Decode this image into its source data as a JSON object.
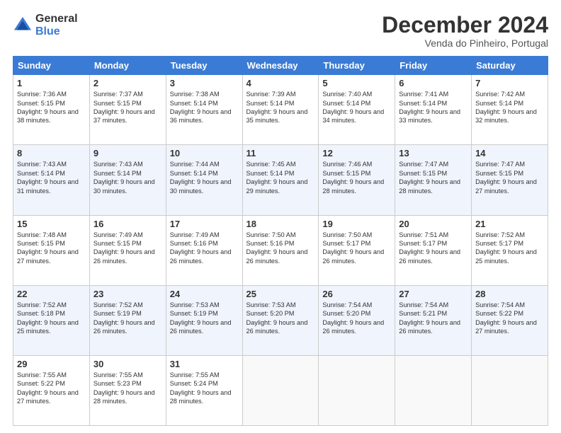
{
  "logo": {
    "general": "General",
    "blue": "Blue"
  },
  "title": "December 2024",
  "location": "Venda do Pinheiro, Portugal",
  "days_of_week": [
    "Sunday",
    "Monday",
    "Tuesday",
    "Wednesday",
    "Thursday",
    "Friday",
    "Saturday"
  ],
  "weeks": [
    [
      {
        "day": "1",
        "sunrise": "7:36 AM",
        "sunset": "5:15 PM",
        "daylight": "9 hours and 38 minutes."
      },
      {
        "day": "2",
        "sunrise": "7:37 AM",
        "sunset": "5:15 PM",
        "daylight": "9 hours and 37 minutes."
      },
      {
        "day": "3",
        "sunrise": "7:38 AM",
        "sunset": "5:14 PM",
        "daylight": "9 hours and 36 minutes."
      },
      {
        "day": "4",
        "sunrise": "7:39 AM",
        "sunset": "5:14 PM",
        "daylight": "9 hours and 35 minutes."
      },
      {
        "day": "5",
        "sunrise": "7:40 AM",
        "sunset": "5:14 PM",
        "daylight": "9 hours and 34 minutes."
      },
      {
        "day": "6",
        "sunrise": "7:41 AM",
        "sunset": "5:14 PM",
        "daylight": "9 hours and 33 minutes."
      },
      {
        "day": "7",
        "sunrise": "7:42 AM",
        "sunset": "5:14 PM",
        "daylight": "9 hours and 32 minutes."
      }
    ],
    [
      {
        "day": "8",
        "sunrise": "7:43 AM",
        "sunset": "5:14 PM",
        "daylight": "9 hours and 31 minutes."
      },
      {
        "day": "9",
        "sunrise": "7:43 AM",
        "sunset": "5:14 PM",
        "daylight": "9 hours and 30 minutes."
      },
      {
        "day": "10",
        "sunrise": "7:44 AM",
        "sunset": "5:14 PM",
        "daylight": "9 hours and 30 minutes."
      },
      {
        "day": "11",
        "sunrise": "7:45 AM",
        "sunset": "5:14 PM",
        "daylight": "9 hours and 29 minutes."
      },
      {
        "day": "12",
        "sunrise": "7:46 AM",
        "sunset": "5:15 PM",
        "daylight": "9 hours and 28 minutes."
      },
      {
        "day": "13",
        "sunrise": "7:47 AM",
        "sunset": "5:15 PM",
        "daylight": "9 hours and 28 minutes."
      },
      {
        "day": "14",
        "sunrise": "7:47 AM",
        "sunset": "5:15 PM",
        "daylight": "9 hours and 27 minutes."
      }
    ],
    [
      {
        "day": "15",
        "sunrise": "7:48 AM",
        "sunset": "5:15 PM",
        "daylight": "9 hours and 27 minutes."
      },
      {
        "day": "16",
        "sunrise": "7:49 AM",
        "sunset": "5:15 PM",
        "daylight": "9 hours and 26 minutes."
      },
      {
        "day": "17",
        "sunrise": "7:49 AM",
        "sunset": "5:16 PM",
        "daylight": "9 hours and 26 minutes."
      },
      {
        "day": "18",
        "sunrise": "7:50 AM",
        "sunset": "5:16 PM",
        "daylight": "9 hours and 26 minutes."
      },
      {
        "day": "19",
        "sunrise": "7:50 AM",
        "sunset": "5:17 PM",
        "daylight": "9 hours and 26 minutes."
      },
      {
        "day": "20",
        "sunrise": "7:51 AM",
        "sunset": "5:17 PM",
        "daylight": "9 hours and 26 minutes."
      },
      {
        "day": "21",
        "sunrise": "7:52 AM",
        "sunset": "5:17 PM",
        "daylight": "9 hours and 25 minutes."
      }
    ],
    [
      {
        "day": "22",
        "sunrise": "7:52 AM",
        "sunset": "5:18 PM",
        "daylight": "9 hours and 25 minutes."
      },
      {
        "day": "23",
        "sunrise": "7:52 AM",
        "sunset": "5:19 PM",
        "daylight": "9 hours and 26 minutes."
      },
      {
        "day": "24",
        "sunrise": "7:53 AM",
        "sunset": "5:19 PM",
        "daylight": "9 hours and 26 minutes."
      },
      {
        "day": "25",
        "sunrise": "7:53 AM",
        "sunset": "5:20 PM",
        "daylight": "9 hours and 26 minutes."
      },
      {
        "day": "26",
        "sunrise": "7:54 AM",
        "sunset": "5:20 PM",
        "daylight": "9 hours and 26 minutes."
      },
      {
        "day": "27",
        "sunrise": "7:54 AM",
        "sunset": "5:21 PM",
        "daylight": "9 hours and 26 minutes."
      },
      {
        "day": "28",
        "sunrise": "7:54 AM",
        "sunset": "5:22 PM",
        "daylight": "9 hours and 27 minutes."
      }
    ],
    [
      {
        "day": "29",
        "sunrise": "7:55 AM",
        "sunset": "5:22 PM",
        "daylight": "9 hours and 27 minutes."
      },
      {
        "day": "30",
        "sunrise": "7:55 AM",
        "sunset": "5:23 PM",
        "daylight": "9 hours and 28 minutes."
      },
      {
        "day": "31",
        "sunrise": "7:55 AM",
        "sunset": "5:24 PM",
        "daylight": "9 hours and 28 minutes."
      },
      null,
      null,
      null,
      null
    ]
  ],
  "labels": {
    "sunrise": "Sunrise:",
    "sunset": "Sunset:",
    "daylight": "Daylight:"
  }
}
